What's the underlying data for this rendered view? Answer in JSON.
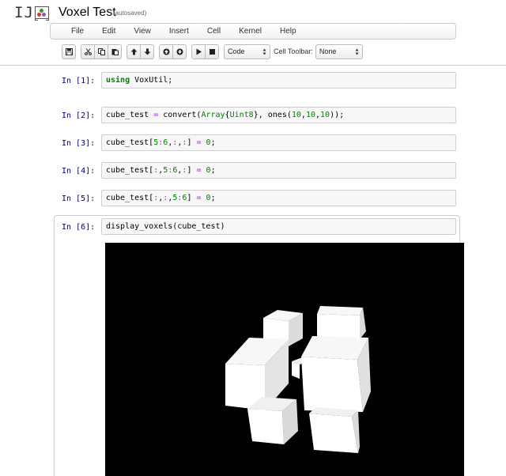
{
  "header": {
    "logo_text": "IJ",
    "notebook_name": "Voxel Test",
    "autosave_status": "(autosaved)"
  },
  "menubar": {
    "items": [
      "File",
      "Edit",
      "View",
      "Insert",
      "Cell",
      "Kernel",
      "Help"
    ]
  },
  "toolbar": {
    "icons": [
      "save-icon",
      "cut-icon",
      "copy-icon",
      "paste-icon",
      "move-up-icon",
      "move-down-icon",
      "insert-above-icon",
      "insert-below-icon",
      "run-icon",
      "stop-icon"
    ],
    "cell_type": "Code",
    "cell_toolbar_label": "Cell Toolbar:",
    "cell_toolbar_value": "None"
  },
  "cells": [
    {
      "prompt": "In [1]:",
      "code": "using VoxUtil;"
    },
    {
      "prompt": "In [2]:",
      "code": "cube_test = convert(Array{Uint8}, ones(10,10,10));"
    },
    {
      "prompt": "In [3]:",
      "code": "cube_test[5:6,:,:] = 0;"
    },
    {
      "prompt": "In [4]:",
      "code": "cube_test[:,5:6,:] = 0;"
    },
    {
      "prompt": "In [5]:",
      "code": "cube_test[:,:,5:6] = 0;"
    },
    {
      "prompt": "In [6]:",
      "code": "display_voxels(cube_test)"
    }
  ],
  "output": {
    "background": "#000000",
    "voxel_color": "#ffffff"
  }
}
